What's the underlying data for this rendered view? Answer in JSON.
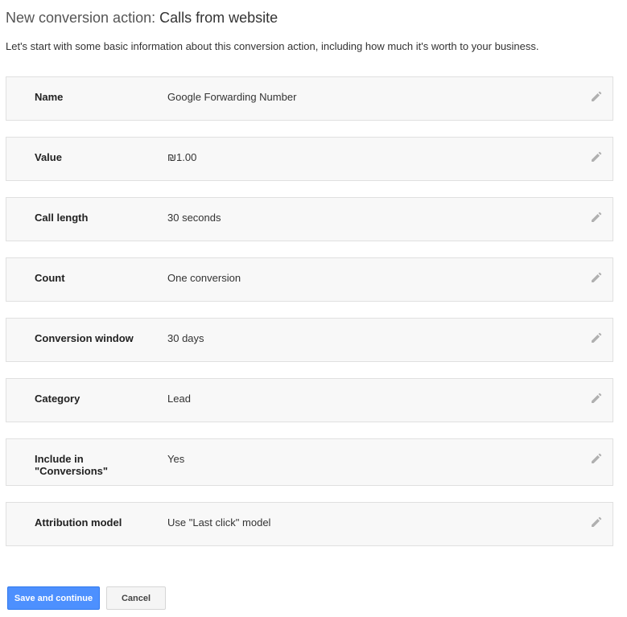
{
  "header": {
    "title_prefix": "New conversion action:",
    "title_name": "Calls from website",
    "subtitle": "Let's start with some basic information about this conversion action, including how much it's worth to your business."
  },
  "rows": [
    {
      "label": "Name",
      "value": "Google Forwarding Number"
    },
    {
      "label": "Value",
      "value": "₪1.00"
    },
    {
      "label": "Call length",
      "value": "30 seconds"
    },
    {
      "label": "Count",
      "value": "One conversion"
    },
    {
      "label": "Conversion window",
      "value": "30 days"
    },
    {
      "label": "Category",
      "value": "Lead"
    },
    {
      "label": "Include in \"Conversions\"",
      "value": "Yes"
    },
    {
      "label": "Attribution model",
      "value": "Use \"Last click\" model"
    }
  ],
  "actions": {
    "save_label": "Save and continue",
    "cancel_label": "Cancel"
  },
  "icons": {
    "edit": "pencil-icon"
  },
  "colors": {
    "primary_button": "#4d90fe",
    "row_background": "#f8f8f8",
    "row_border": "#e0e0e0",
    "icon": "#b0b0b0"
  }
}
